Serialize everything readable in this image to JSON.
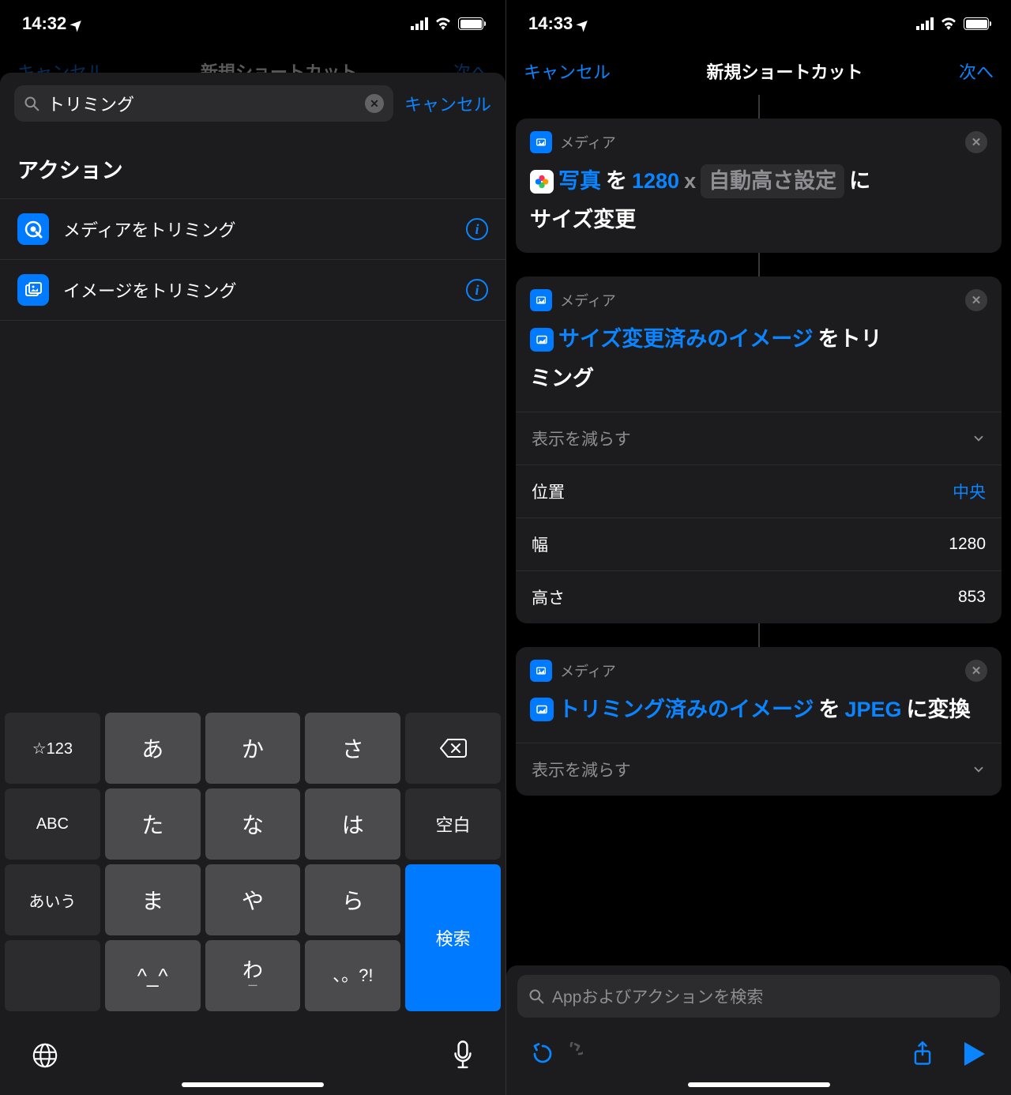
{
  "left": {
    "status_time": "14:32",
    "nav_dim_cancel": "キャンセル",
    "nav_dim_title": "新規ショートカット",
    "nav_dim_next": "次へ",
    "search_value": "トリミング",
    "search_cancel": "キャンセル",
    "section_title": "アクション",
    "actions": [
      {
        "label": "メディアをトリミング"
      },
      {
        "label": "イメージをトリミング"
      }
    ],
    "keys": {
      "star123": "☆123",
      "a": "あ",
      "ka": "か",
      "sa": "さ",
      "abc": "ABC",
      "ta": "た",
      "na": "な",
      "ha": "は",
      "space": "空白",
      "aiu": "あいう",
      "ma": "ま",
      "ya": "や",
      "ra": "ら",
      "search": "検索",
      "face": "^_^",
      "wa": "わ",
      "punct": "、。?!"
    }
  },
  "right": {
    "status_time": "14:33",
    "nav_cancel": "キャンセル",
    "nav_title": "新規ショートカット",
    "nav_next": "次へ",
    "block1": {
      "cat": "メディア",
      "t_photos": "写真",
      "t_wo": "を",
      "t_width": "1280",
      "t_x": "x",
      "t_autoheight": "自動高さ設定",
      "t_ni": "に",
      "t_resize": "サイズ変更"
    },
    "block2": {
      "cat": "メディア",
      "t_input": "サイズ変更済みのイメージ",
      "t_suffix1": "をトリ",
      "t_suffix2": "ミング",
      "expand": "表示を減らす",
      "rows": {
        "pos_label": "位置",
        "pos_value": "中央",
        "w_label": "幅",
        "w_value": "1280",
        "h_label": "高さ",
        "h_value": "853"
      }
    },
    "block3": {
      "cat": "メディア",
      "t_input": "トリミング済みのイメージ",
      "t_wo": "を",
      "t_jpeg": "JPEG",
      "t_conv": "に変換",
      "expand": "表示を減らす"
    },
    "bottom_search_placeholder": "Appおよびアクションを検索"
  }
}
